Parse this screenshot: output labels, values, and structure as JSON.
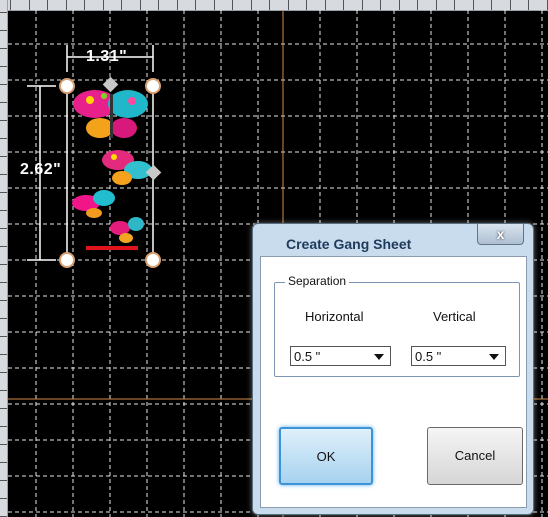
{
  "canvas": {
    "width_label": "1.31\"",
    "height_label": "2.62\""
  },
  "dialog": {
    "title": "Create Gang Sheet",
    "close_label": "x",
    "separation_group_label": "Separation",
    "horizontal_label": "Horizontal",
    "vertical_label": "Vertical",
    "horizontal_value": "0.5 \"",
    "vertical_value": "0.5 \"",
    "ok_label": "OK",
    "cancel_label": "Cancel"
  },
  "colors": {
    "canvas_bg": "#000000",
    "grid": "#ffffff",
    "guide": "#d08a4a",
    "dialog_frame": "#c9dcee",
    "ok_border": "#3c93d6"
  }
}
